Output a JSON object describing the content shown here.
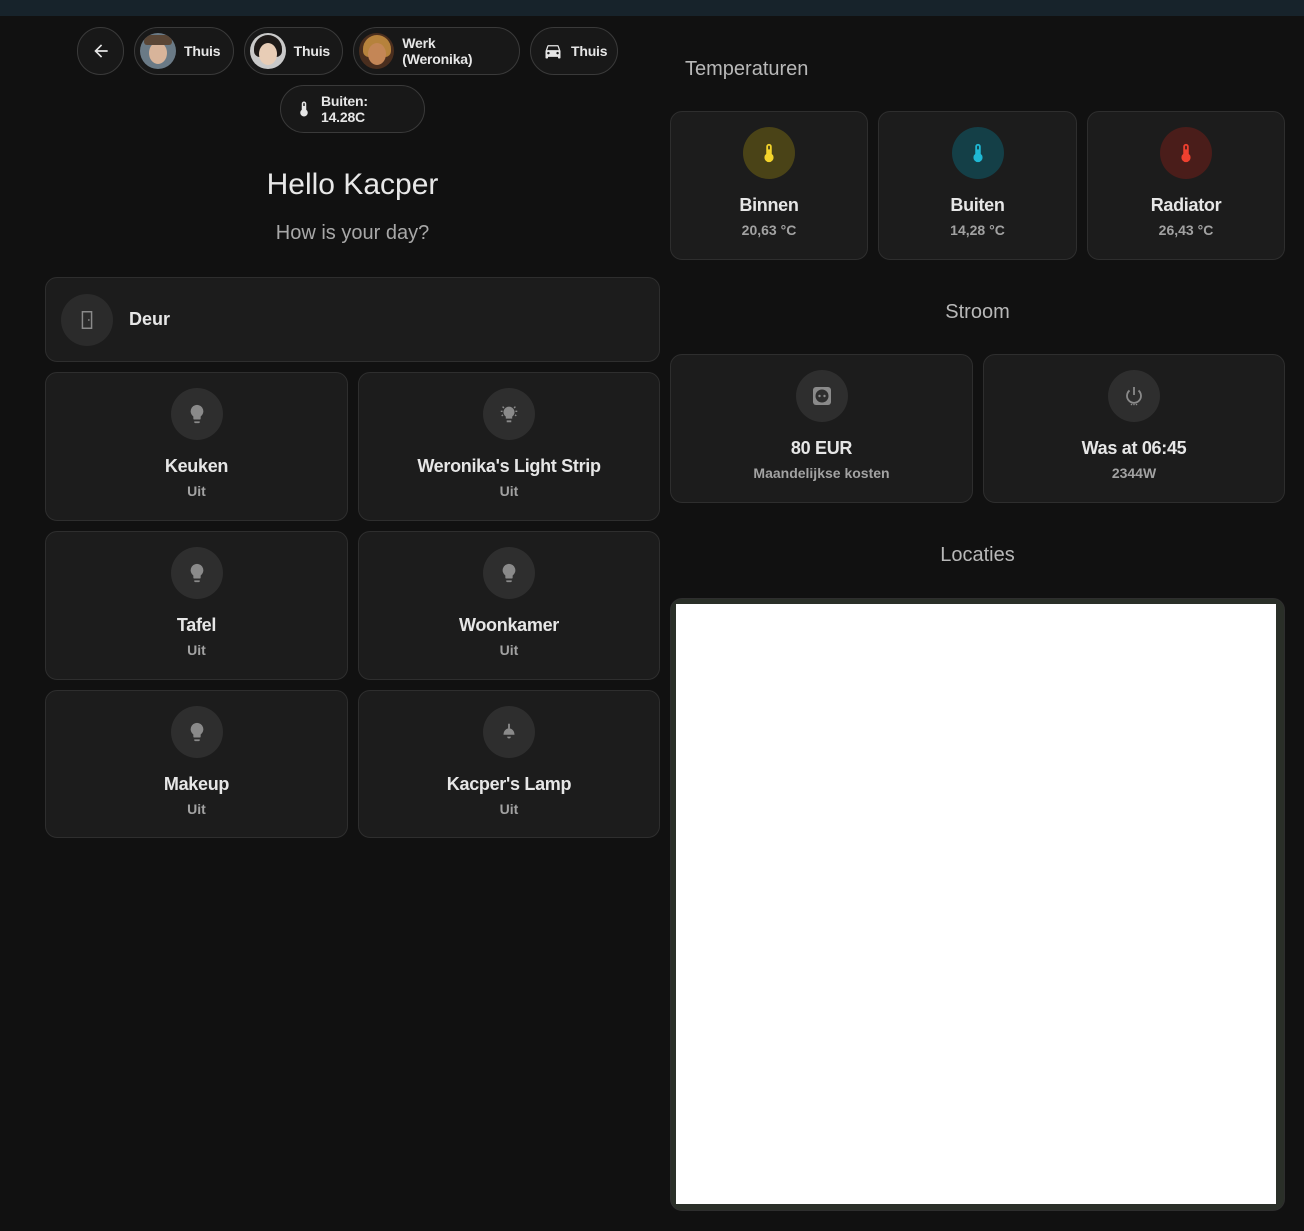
{
  "chips": {
    "back": {
      "icon": "arrow-left-icon"
    },
    "persons": [
      {
        "label": "Thuis",
        "avatar": "person-avatar"
      },
      {
        "label": "Thuis",
        "avatar": "person-avatar"
      },
      {
        "label": "Werk (Weronika)",
        "avatar": "person-avatar"
      },
      {
        "label": "Thuis",
        "icon": "car-icon"
      }
    ],
    "temperature": {
      "label": "Buiten: 14.28C",
      "icon": "thermometer-icon"
    }
  },
  "greeting": {
    "title": "Hello Kacper",
    "subtitle": "How is your day?"
  },
  "door": {
    "name": "Deur",
    "icon": "door-icon"
  },
  "lights": [
    {
      "name": "Keuken",
      "state": "Uit",
      "icon": "lightbulb-icon"
    },
    {
      "name": "Weronika's Light Strip",
      "state": "Uit",
      "icon": "light-strip-icon"
    },
    {
      "name": "Tafel",
      "state": "Uit",
      "icon": "lightbulb-icon"
    },
    {
      "name": "Woonkamer",
      "state": "Uit",
      "icon": "lightbulb-icon"
    },
    {
      "name": "Makeup",
      "state": "Uit",
      "icon": "lightbulb-icon"
    },
    {
      "name": "Kacper's Lamp",
      "state": "Uit",
      "icon": "ceiling-lamp-icon"
    }
  ],
  "temperatures": {
    "title": "Temperaturen",
    "items": [
      {
        "name": "Binnen",
        "value": "20,63 °C",
        "color": "#f3d42b",
        "bg": "#4a4317"
      },
      {
        "name": "Buiten",
        "value": "14,28 °C",
        "color": "#1fb8d4",
        "bg": "#143f47"
      },
      {
        "name": "Radiator",
        "value": "26,43 °C",
        "color": "#f0402f",
        "bg": "#4a1d1a"
      }
    ]
  },
  "power": {
    "title": "Stroom",
    "items": [
      {
        "name": "80 EUR",
        "sub": "Maandelijkse kosten",
        "icon": "power-socket-icon"
      },
      {
        "name": "Was at 06:45",
        "sub": "2344W",
        "icon": "power-standby-icon"
      }
    ]
  },
  "locations": {
    "title": "Locaties"
  }
}
